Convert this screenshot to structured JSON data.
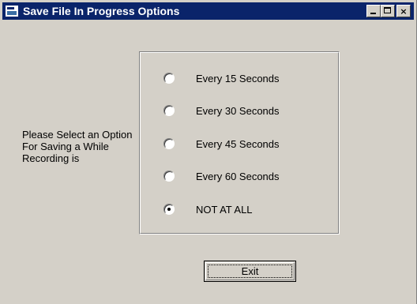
{
  "window": {
    "title": "Save File In Progress Options",
    "titlebar_color": "#0a246a",
    "face_color": "#d4d0c8"
  },
  "icons": {
    "window_icon": "app-window-icon",
    "minimize": "minimize-icon",
    "maximize": "maximize-icon",
    "close": "close-icon",
    "close_glyph": "×"
  },
  "prompt": {
    "text": "Please Select an Option For Saving a While Recording is"
  },
  "options": [
    {
      "label": "Every 15 Seconds",
      "checked": false
    },
    {
      "label": "Every 30 Seconds",
      "checked": false
    },
    {
      "label": "Every 45 Seconds",
      "checked": false
    },
    {
      "label": "Every 60 Seconds",
      "checked": false
    },
    {
      "label": "NOT AT ALL",
      "checked": true
    }
  ],
  "buttons": {
    "exit_label": "Exit"
  }
}
